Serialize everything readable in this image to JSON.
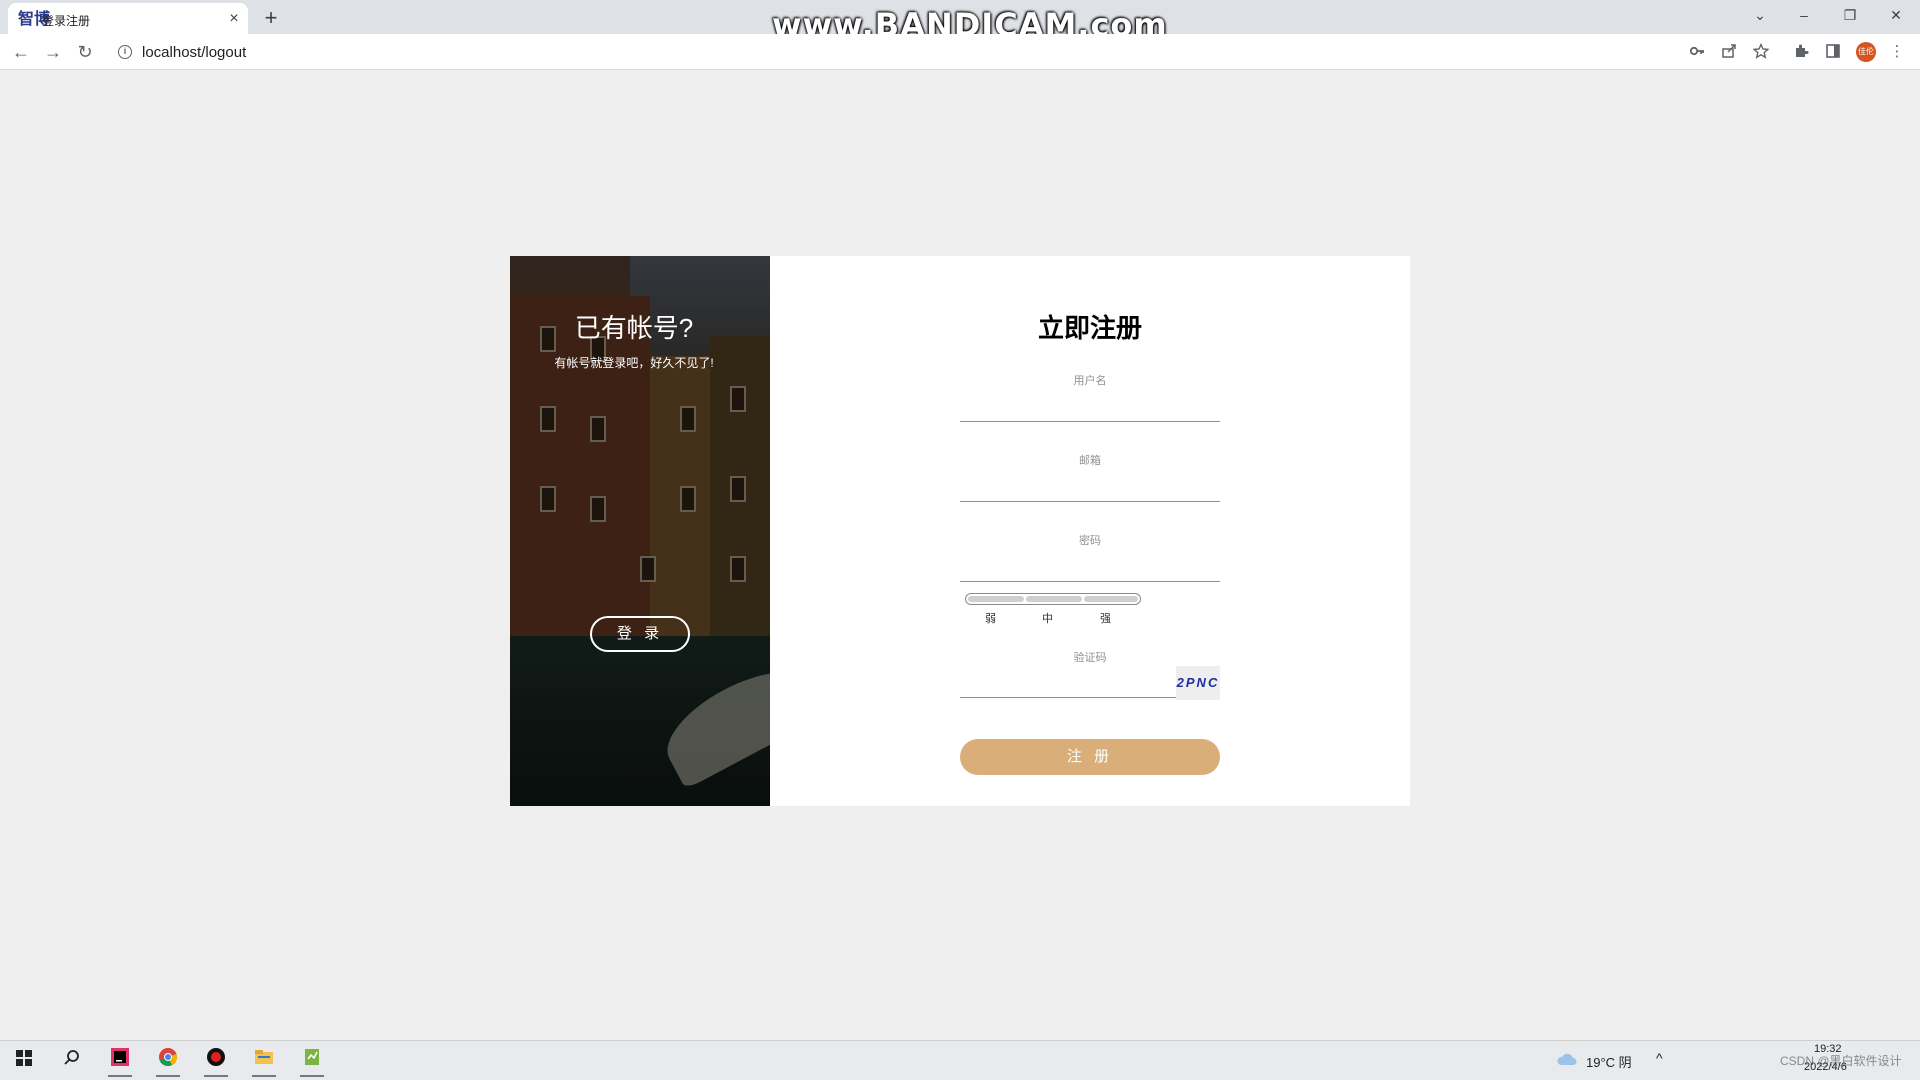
{
  "browser": {
    "tab_favicon_text": "智博",
    "tab_title": "登录注册",
    "tab_close": "×",
    "new_tab": "+",
    "watermark": "www.BANDICAM.com",
    "window_controls": [
      "⌄",
      "–",
      "❐",
      "✕"
    ],
    "back": "←",
    "forward": "→",
    "reload": "↻",
    "info": "i",
    "url": "localhost/logout",
    "toolbar_icons": [
      "key-icon",
      "share-icon",
      "star-icon",
      "extensions-icon",
      "sidepanel-icon"
    ],
    "profile_text": "佳伦",
    "menu": "⋮"
  },
  "side_panel": {
    "title": "已有帐号?",
    "subtitle": "有帐号就登录吧，好久不见了!",
    "login_label": "登 录"
  },
  "form": {
    "title": "立即注册",
    "username_label": "用户名",
    "email_label": "邮箱",
    "password_label": "密码",
    "strength_labels": [
      "弱",
      "中",
      "强"
    ],
    "captcha_label": "验证码",
    "captcha_text": "2PNC",
    "submit_label": "注 册"
  },
  "taskbar": {
    "weather": "19°C 阴",
    "time": "19:32",
    "date": "2022/4/6",
    "tray_text": "CSDN @黑白软件设计"
  },
  "colors": {
    "submit_button": "#d9ae78",
    "captcha_text": "#1f2fa0",
    "page_background": "#efefef"
  }
}
